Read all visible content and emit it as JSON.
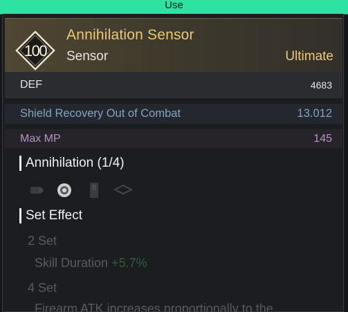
{
  "use_button": {
    "label": "Use"
  },
  "item": {
    "level": "100",
    "name": "Annihilation Sensor",
    "type": "Sensor",
    "grade": "Ultimate",
    "colors": {
      "name": "#ecc87a",
      "grade": "#ecc87a"
    }
  },
  "base_stat": {
    "label": "DEF",
    "value": "4683"
  },
  "stats": [
    {
      "label": "Shield Recovery Out of Combat",
      "value": "13.012",
      "color": "#7fa4c4"
    },
    {
      "label": "Max MP",
      "value": "145",
      "color": "#b892c8"
    }
  ],
  "set_pieces": {
    "title": "Annihilation (1/4)",
    "icons": [
      "sensor-piece-icon",
      "sensor-equipped-icon",
      "module-piece-icon",
      "crown-piece-icon"
    ]
  },
  "set_effect": {
    "title": "Set Effect",
    "tiers": [
      {
        "label": "2 Set",
        "effect_name": "Skill Duration",
        "effect_value": "+5.7%"
      },
      {
        "label": "4 Set",
        "effect_text": "Firearm ATK increases proportionally to the"
      }
    ]
  }
}
